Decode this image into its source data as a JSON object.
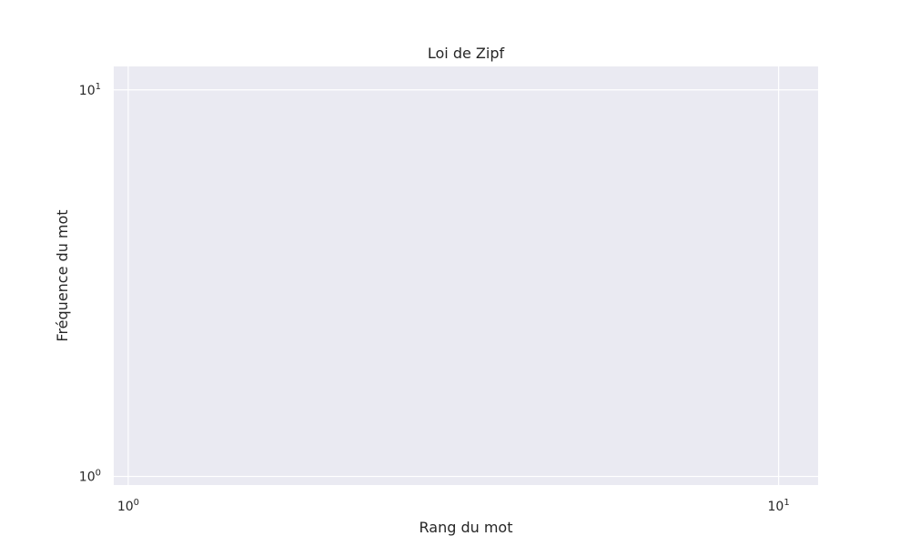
{
  "chart_data": {
    "type": "line",
    "title": "Loi de Zipf",
    "xlabel": "Rang du mot",
    "ylabel": "Fréquence du mot",
    "xscale": "log",
    "yscale": "log",
    "xlim": [
      0.95,
      11.5
    ],
    "ylim": [
      0.95,
      11.5
    ],
    "grid": true,
    "style": "seaborn-darkgrid",
    "colors": {
      "plot_background": "#eaeaf2",
      "grid": "#ffffff",
      "text": "#262626"
    },
    "x_ticks": [
      {
        "value": 1,
        "base": "10",
        "exp": "0"
      },
      {
        "value": 10,
        "base": "10",
        "exp": "1"
      }
    ],
    "y_ticks": [
      {
        "value": 1,
        "base": "10",
        "exp": "0"
      },
      {
        "value": 10,
        "base": "10",
        "exp": "1"
      }
    ],
    "series": []
  }
}
